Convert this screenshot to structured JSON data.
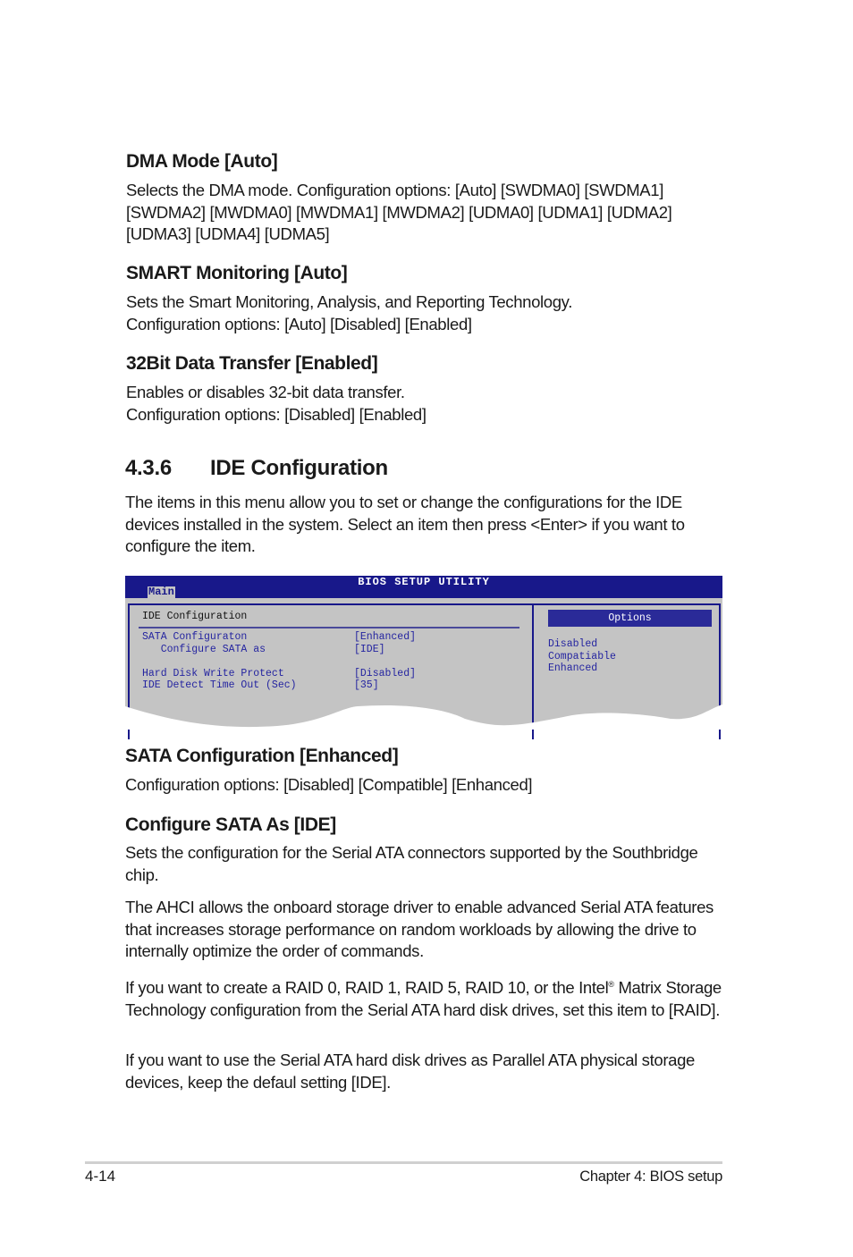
{
  "sections": [
    {
      "heading": "DMA Mode [Auto]",
      "body": "Selects the DMA mode. Configuration options: [Auto] [SWDMA0] [SWDMA1] [SWDMA2] [MWDMA0] [MWDMA1] [MWDMA2] [UDMA0] [UDMA1] [UDMA2] [UDMA3] [UDMA4] [UDMA5]"
    },
    {
      "heading": "SMART Monitoring [Auto]",
      "body1": "Sets the Smart Monitoring, Analysis, and Reporting Technology.",
      "body2": "Configuration options: [Auto] [Disabled] [Enabled]"
    },
    {
      "heading": "32Bit Data Transfer [Enabled]",
      "body1": "Enables or disables 32-bit data transfer.",
      "body2": "Configuration options: [Disabled] [Enabled]"
    }
  ],
  "chapter_section": {
    "number": "4.3.6",
    "title": "IDE Configuration",
    "body": "The items in this menu allow you to set or change the configurations for the IDE devices installed in the system. Select an item then press <Enter> if you want to configure the item."
  },
  "bios": {
    "title": "BIOS SETUP UTILITY",
    "tab": "Main",
    "panel_title": "IDE Configuration",
    "items": [
      {
        "label": "SATA Configuraton",
        "value": "[Enhanced]"
      },
      {
        "label": "   Configure SATA as",
        "value": "[IDE]"
      },
      {
        "label": "Hard Disk Write Protect",
        "value": "[Disabled]"
      },
      {
        "label": "IDE Detect Time Out (Sec)",
        "value": "[35]"
      }
    ],
    "options_title": "Options",
    "options": [
      "Disabled",
      "Compatiable",
      "Enhanced"
    ],
    "colors": {
      "bar": "#18188a",
      "panel": "#c4c4c4",
      "text": "#2424a0"
    }
  },
  "sata_config": {
    "heading": "SATA Configuration [Enhanced]",
    "body": "Configuration options: [Disabled] [Compatible] [Enhanced]"
  },
  "configure_sata": {
    "heading": "Configure SATA As [IDE]",
    "p1": "Sets the configuration for the Serial ATA connectors supported by the Southbridge chip.",
    "p2": "The AHCI allows the onboard storage driver to enable advanced Serial ATA features that increases storage performance on random workloads by allowing the drive to internally optimize the order of commands.",
    "p3a": "If you want to create a RAID 0, RAID 1,  RAID 5,  RAID 10, or the Intel",
    "p3sup": "®",
    "p3b": " Matrix Storage Technology configuration from the Serial ATA hard disk drives, set this item to [RAID].",
    "p4": "If you want to use the Serial ATA hard disk drives as Parallel ATA physical storage devices, keep the defaul setting [IDE]."
  },
  "footer": {
    "page": "4-14",
    "chapter": "Chapter 4: BIOS setup"
  }
}
